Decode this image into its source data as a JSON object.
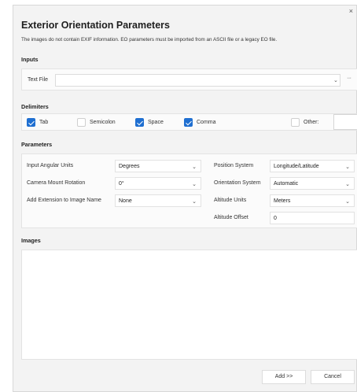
{
  "dialog": {
    "close_glyph": "×",
    "title": "Exterior Orientation Parameters",
    "subtitle": "The images do not contain EXIF information. EO parameters must be imported from an ASCII file or a legacy EO file."
  },
  "inputs": {
    "section_label": "Inputs",
    "field_label": "Text File",
    "field_value": "",
    "browse_label": "···"
  },
  "delimiters": {
    "section_label": "Delimiters",
    "items": [
      {
        "label": "Tab",
        "checked": true
      },
      {
        "label": "Semicolon",
        "checked": false
      },
      {
        "label": "Space",
        "checked": true
      },
      {
        "label": "Comma",
        "checked": true
      },
      {
        "label": "Other:",
        "checked": false
      }
    ],
    "other_value": ""
  },
  "parameters": {
    "section_label": "Parameters",
    "input_angular_units": {
      "label": "Input Angular Units",
      "value": "Degrees"
    },
    "camera_mount_rotation": {
      "label": "Camera Mount Rotation",
      "value": "0°"
    },
    "add_extension": {
      "label": "Add Extension to Image Name",
      "value": "None"
    },
    "position_system": {
      "label": "Position System",
      "value": "Longitude/Latitude"
    },
    "orientation_system": {
      "label": "Orientation System",
      "value": "Automatic"
    },
    "altitude_units": {
      "label": "Altitude Units",
      "value": "Meters"
    },
    "altitude_offset": {
      "label": "Altitude Offset",
      "value": "0"
    }
  },
  "images": {
    "section_label": "Images"
  },
  "buttons": {
    "add": "Add >>",
    "cancel": "Cancel"
  },
  "colors": {
    "accent": "#1f6fd1",
    "dialog_bg": "#f3f3f3"
  }
}
